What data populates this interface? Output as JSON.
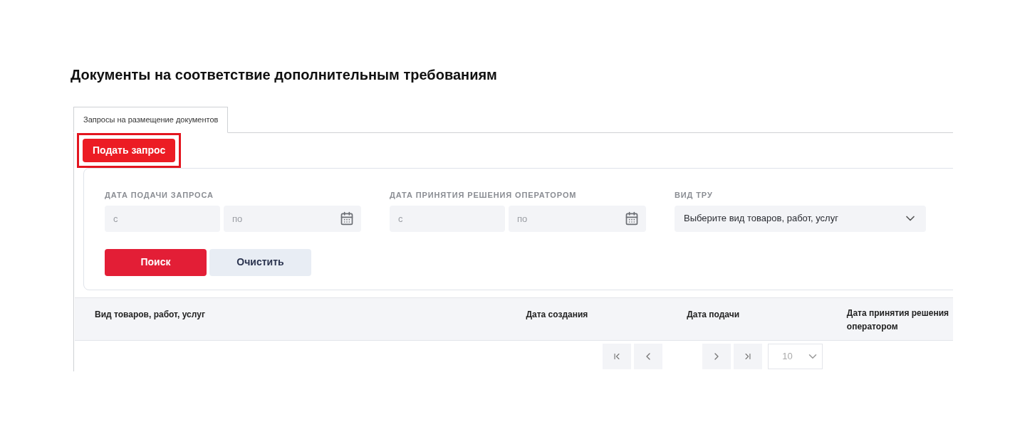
{
  "page_title": "Документы на соответствие дополнительным требованиям",
  "tabs": [
    {
      "label": "Запросы на размещение документов",
      "selected": true
    }
  ],
  "submit_button": {
    "label": "Подать запрос",
    "highlighted": true
  },
  "filters": [
    {
      "label": "ДАТА ПОДАЧИ ЗАПРОСА",
      "kind": "date_range",
      "from_placeholder": "с",
      "to_placeholder": "по"
    },
    {
      "label": "ДАТА ПРИНЯТИЯ РЕШЕНИЯ ОПЕРАТОРОМ",
      "kind": "date_range",
      "from_placeholder": "с",
      "to_placeholder": "по"
    },
    {
      "label": "ВИД ТРУ",
      "kind": "select",
      "placeholder": "Выберите вид товаров, работ, услуг"
    }
  ],
  "actions": {
    "search": "Поиск",
    "clear": "Очистить"
  },
  "table": {
    "columns": [
      "Вид товаров, работ, услуг",
      "Дата создания",
      "Дата подачи",
      "Дата принятия решения оператором"
    ]
  },
  "pagination": {
    "page_size": "10"
  }
}
